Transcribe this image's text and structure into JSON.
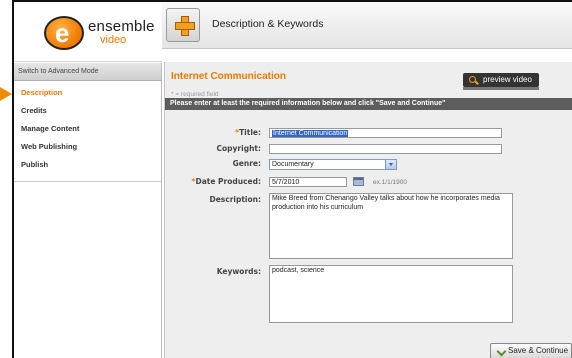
{
  "brand": {
    "name": "ensemble",
    "sub": "video",
    "accent": "#f07800"
  },
  "header": {
    "title": "Description & Keywords",
    "icon": "add-content-icon"
  },
  "sidebar": {
    "mode_link": "Switch to Advanced Mode",
    "items": [
      {
        "label": "Description",
        "active": true
      },
      {
        "label": "Credits",
        "active": false
      },
      {
        "label": "Manage Content",
        "active": false
      },
      {
        "label": "Web Publishing",
        "active": false
      },
      {
        "label": "Publish",
        "active": false
      }
    ]
  },
  "main": {
    "page_title": "Internet Communication",
    "preview_label": "preview video",
    "required_star": "*",
    "required_note": " = required field",
    "instructions": "Please enter at least the required information below and click \"Save and Continue\"",
    "form": {
      "title_label": "Title:",
      "title_value": "Internet Communication",
      "copyright_label": "Copyright:",
      "copyright_value": "",
      "genre_label": "Genre:",
      "genre_value": "Documentary",
      "date_label": "Date Produced:",
      "date_value": "5/7/2010",
      "date_hint": "ex.1/1/1900",
      "description_label": "Description:",
      "description_value": "Mike Breed from Chenango Valley talks about how he incorporates media production into his curriculum",
      "keywords_label": "Keywords:",
      "keywords_value": "podcast, science"
    },
    "save_label": "Save & Continue"
  }
}
